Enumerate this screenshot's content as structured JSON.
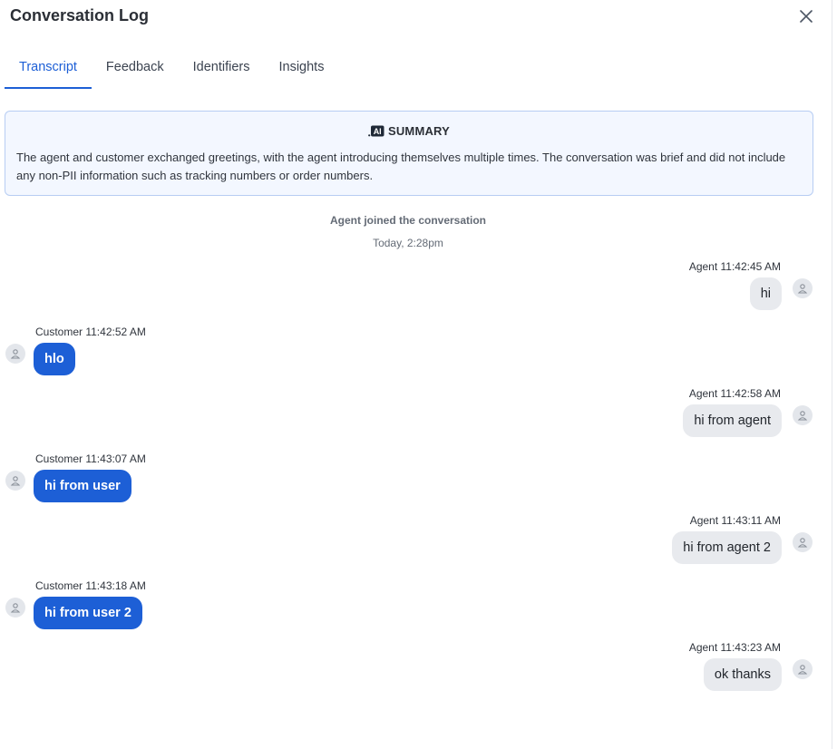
{
  "header": {
    "title": "Conversation Log"
  },
  "tabs": [
    {
      "label": "Transcript"
    },
    {
      "label": "Feedback"
    },
    {
      "label": "Identifiers"
    },
    {
      "label": "Insights"
    }
  ],
  "summary": {
    "title": "SUMMARY",
    "text": "The agent and customer exchanged greetings, with the agent introducing themselves multiple times. The conversation was brief and did not include any non-PII information such as tracking numbers or order numbers."
  },
  "system": {
    "joined": "Agent joined the conversation",
    "date": "Today, 2:28pm"
  },
  "messages": [
    {
      "sender": "agent",
      "meta": "Agent 11:42:45 AM",
      "text": "hi"
    },
    {
      "sender": "customer",
      "meta": "Customer 11:42:52 AM",
      "text": "hlo"
    },
    {
      "sender": "agent",
      "meta": "Agent 11:42:58 AM",
      "text": "hi from agent"
    },
    {
      "sender": "customer",
      "meta": "Customer 11:43:07 AM",
      "text": "hi from user"
    },
    {
      "sender": "agent",
      "meta": "Agent 11:43:11 AM",
      "text": "hi from agent 2"
    },
    {
      "sender": "customer",
      "meta": "Customer 11:43:18 AM",
      "text": "hi from user 2"
    },
    {
      "sender": "agent",
      "meta": "Agent 11:43:23 AM",
      "text": "ok thanks"
    }
  ],
  "colors": {
    "accent": "#1d5fd6",
    "agent_bubble": "#e8eaee",
    "summary_bg": "#f3f7ff"
  },
  "icons": {
    "close": "close-icon",
    "ai": "ai-icon",
    "avatar": "user-avatar-icon"
  }
}
